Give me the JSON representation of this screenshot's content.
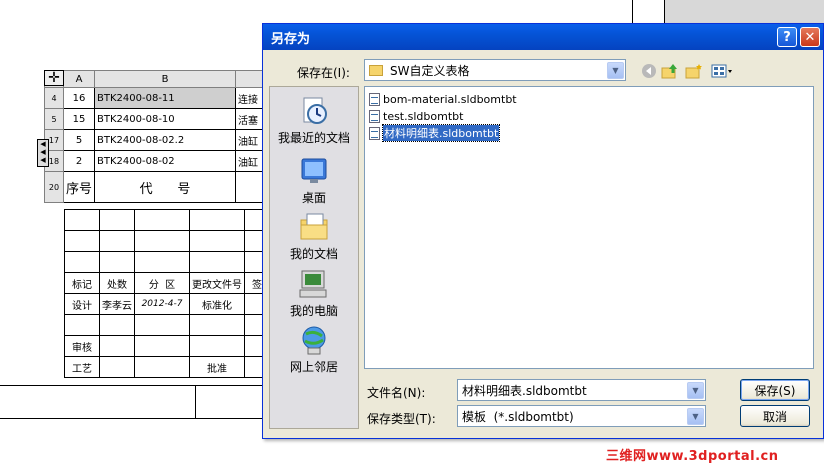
{
  "bom": {
    "columns": [
      "A",
      "B"
    ],
    "rows": [
      {
        "num": "4",
        "a": "16",
        "b": "BTK2400-08-11",
        "c": "连接"
      },
      {
        "num": "5",
        "a": "15",
        "b": "BTK2400-08-10",
        "c": "活塞"
      },
      {
        "num": "17",
        "a": "5",
        "b": "BTK2400-08-02.2",
        "c": "油缸"
      },
      {
        "num": "18",
        "a": "2",
        "b": "BTK2400-08-02",
        "c": "油缸"
      }
    ],
    "header_row": {
      "num": "20",
      "seq": "序号",
      "code": "代      号"
    }
  },
  "titleblock": {
    "row1": [
      "标记",
      "处数",
      "分  区",
      "更改文件号",
      "签名"
    ],
    "row2": [
      "设计",
      "李孝云",
      "2012-4-7",
      "标准化"
    ],
    "row3": [
      "审核"
    ],
    "row4": [
      "工艺",
      "批准"
    ]
  },
  "dialog": {
    "title": "另存为",
    "help_glyph": "?",
    "close_glyph": "✕",
    "save_in_label": "保存在(I):",
    "save_in_value": "SW自定义表格",
    "places": [
      {
        "label": "我最近的文档",
        "icon": "recent-documents-icon"
      },
      {
        "label": "桌面",
        "icon": "desktop-icon"
      },
      {
        "label": "我的文档",
        "icon": "my-documents-icon"
      },
      {
        "label": "我的电脑",
        "icon": "my-computer-icon"
      },
      {
        "label": "网上邻居",
        "icon": "network-places-icon"
      }
    ],
    "files": [
      {
        "name": "bom-material.sldbomtbt",
        "selected": false
      },
      {
        "name": "test.sldbomtbt",
        "selected": false
      },
      {
        "name": "材料明细表.sldbomtbt",
        "selected": true
      }
    ],
    "filename_label": "文件名(N):",
    "filename_value": "材料明细表.sldbomtbt",
    "filetype_label": "保存类型(T):",
    "filetype_value": "模板  (*.sldbomtbt)",
    "save_button": "保存(S)",
    "cancel_button": "取消"
  },
  "watermark": "三维网www.3dportal.cn"
}
